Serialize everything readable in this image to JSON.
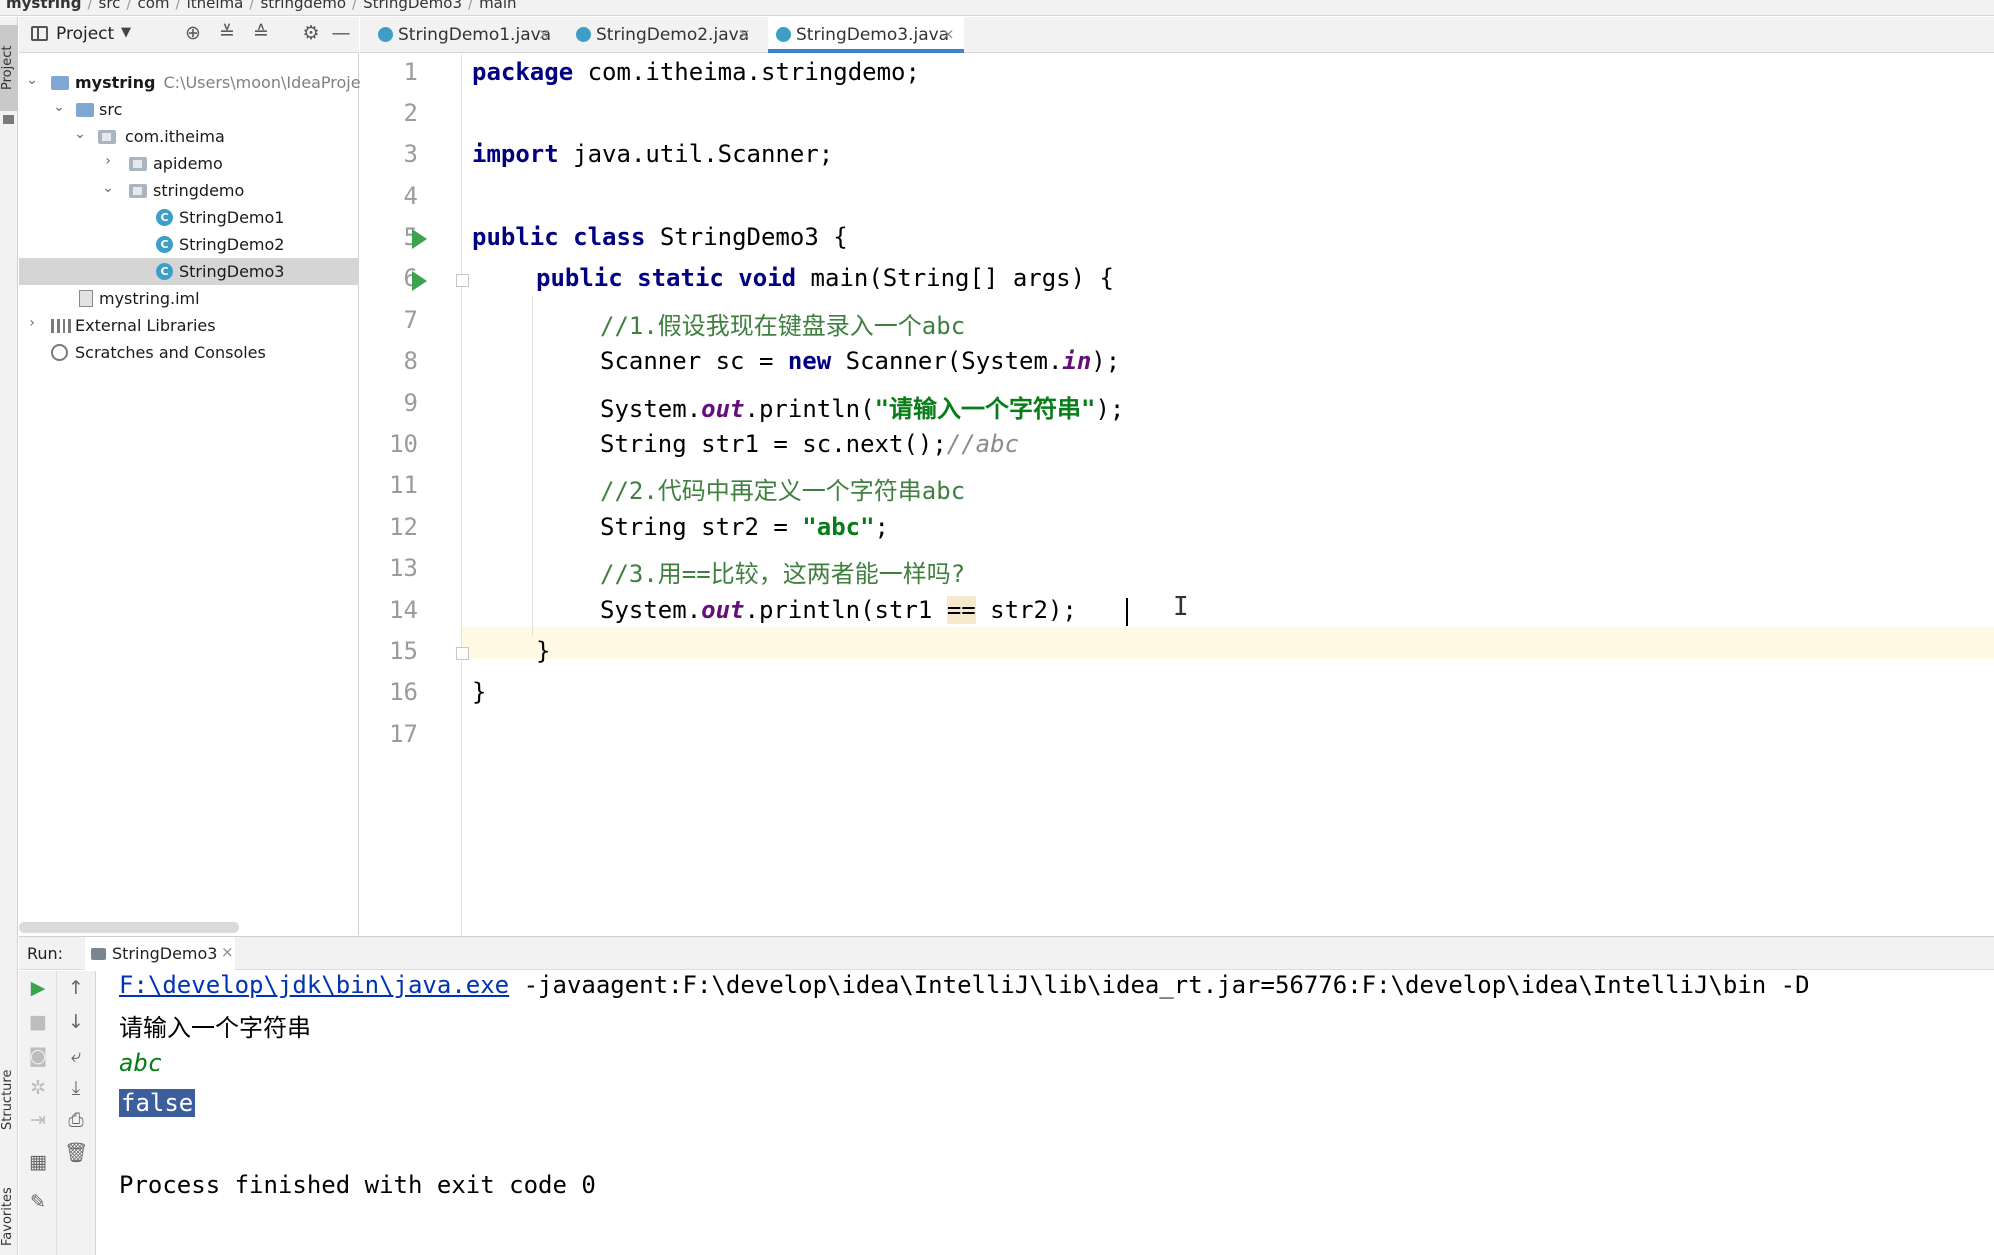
{
  "breadcrumb": {
    "project": "mystring",
    "items": [
      "src",
      "com",
      "itheima",
      "stringdemo",
      "StringDemo3",
      "main"
    ]
  },
  "side_tabs": {
    "project": "Project",
    "structure": "Structure",
    "favorites": "Favorites"
  },
  "project_panel": {
    "title": "Project",
    "tree": [
      {
        "label": "mystring",
        "path": "C:\\Users\\moon\\IdeaProjec"
      },
      {
        "label": "src"
      },
      {
        "label": "com.itheima"
      },
      {
        "label": "apidemo"
      },
      {
        "label": "stringdemo"
      },
      {
        "label": "StringDemo1"
      },
      {
        "label": "StringDemo2"
      },
      {
        "label": "StringDemo3"
      },
      {
        "label": "mystring.iml"
      },
      {
        "label": "External Libraries"
      },
      {
        "label": "Scratches and Consoles"
      }
    ]
  },
  "editor_tabs": [
    {
      "label": "StringDemo1.java"
    },
    {
      "label": "StringDemo2.java"
    },
    {
      "label": "StringDemo3.java",
      "active": true
    }
  ],
  "editor": {
    "line_numbers": [
      "1",
      "2",
      "3",
      "4",
      "5",
      "6",
      "7",
      "8",
      "9",
      "10",
      "11",
      "12",
      "13",
      "14",
      "15",
      "16",
      "17"
    ],
    "current_line": 14,
    "code": {
      "l1_kw": "package",
      "l1_rest": " com.itheima.stringdemo;",
      "l3_kw": "import",
      "l3_rest": " java.util.Scanner;",
      "l5_kw": "public class",
      "l5_rest": " StringDemo3 {",
      "l6_kw": "public static void",
      "l6_rest": " main(String[] args) {",
      "l7_comment": "//1.假设我现在键盘录入一个abc",
      "l8_a": "Scanner sc = ",
      "l8_kw": "new",
      "l8_b": " Scanner(System.",
      "l8_fld": "in",
      "l8_c": ");",
      "l9_a": "System.",
      "l9_fld": "out",
      "l9_b": ".println(",
      "l9_str": "\"请输入一个字符串\"",
      "l9_c": ");",
      "l10_a": "String str1 = sc.next();",
      "l10_cmt": "//abc",
      "l11_comment": "//2.代码中再定义一个字符串abc",
      "l12_a": "String str2 = ",
      "l12_str": "\"abc\"",
      "l12_c": ";",
      "l13_comment": "//3.用==比较，这两者能一样吗?",
      "l14_a": "System.",
      "l14_fld": "out",
      "l14_b": ".println(str1 ",
      "l14_op": "==",
      "l14_c": " str2);",
      "l15": "}",
      "l16": "}"
    }
  },
  "run": {
    "label": "Run:",
    "tab": "StringDemo3",
    "console": {
      "cmd_link": "F:\\develop\\jdk\\bin\\java.exe",
      "cmd_rest": " -javaagent:F:\\develop\\idea\\IntelliJ\\lib\\idea_rt.jar=56776:F:\\develop\\idea\\IntelliJ\\bin -D",
      "prompt": "请输入一个字符串",
      "input": "abc",
      "result": "false",
      "finished": "Process finished with exit code 0"
    }
  },
  "colors": {
    "run_green": "#3ba34d",
    "keyword": "#000080",
    "string": "#067d17",
    "field": "#660e7a",
    "selection": "#3d5e9c",
    "active_tab": "#4083c9"
  }
}
